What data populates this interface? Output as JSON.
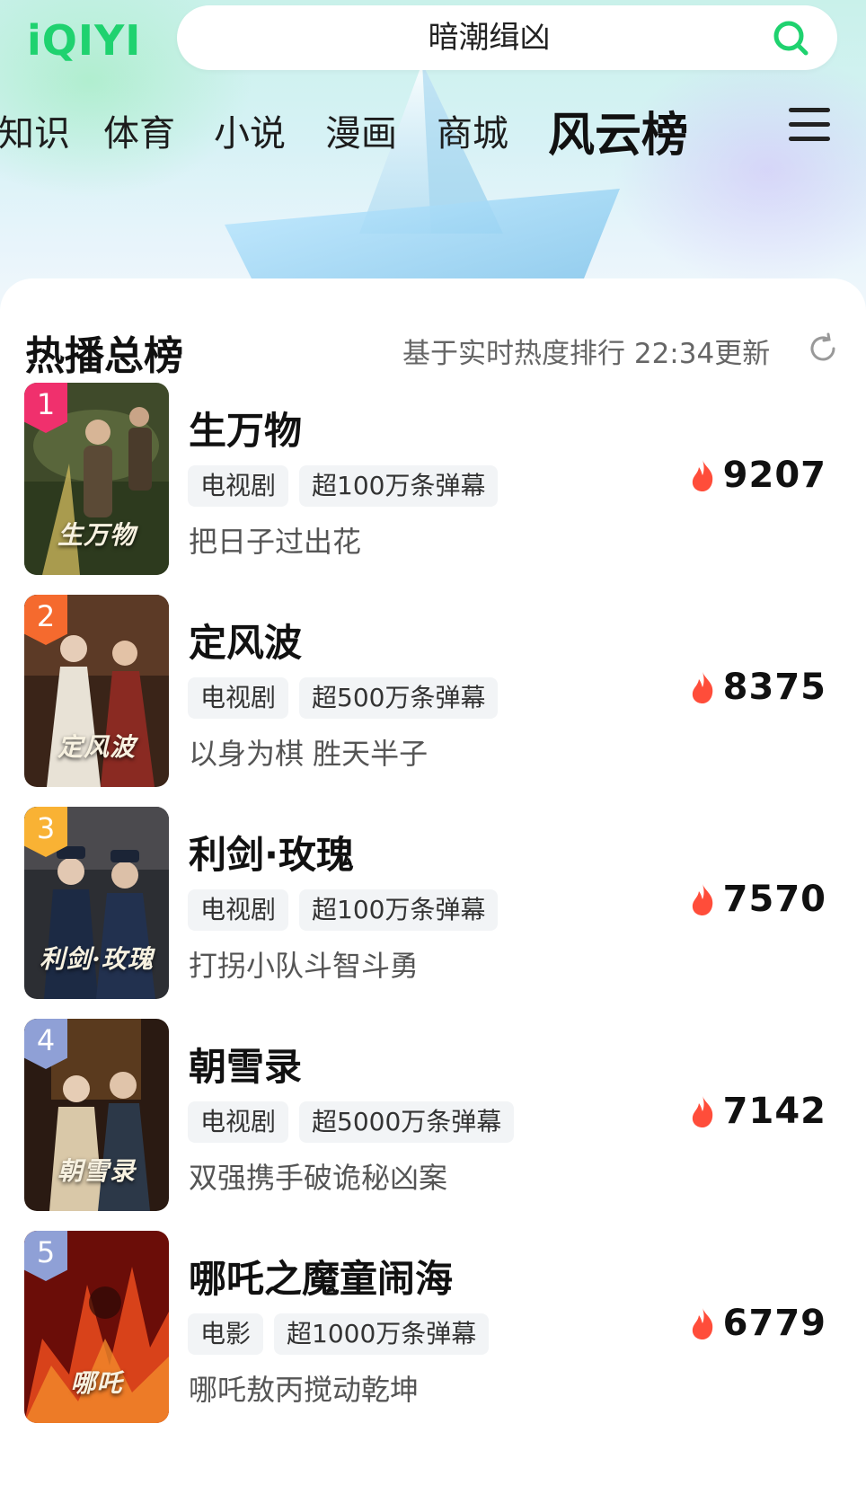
{
  "app": {
    "logo": "iQIYI"
  },
  "search": {
    "query": "暗潮缉凶"
  },
  "nav": {
    "tabs": [
      "知识",
      "体育",
      "小说",
      "漫画",
      "商城",
      "风云榜"
    ],
    "active": "风云榜"
  },
  "ranking": {
    "title": "热播总榜",
    "subtitle": "基于实时热度排行 22:34更新",
    "items": [
      {
        "rank": "1",
        "name": "生万物",
        "tags": [
          "电视剧",
          "超100万条弹幕"
        ],
        "desc": "把日子过出花",
        "heat": "9207",
        "poster_text": "生万物",
        "rank_color": "#f0306d"
      },
      {
        "rank": "2",
        "name": "定风波",
        "tags": [
          "电视剧",
          "超500万条弹幕"
        ],
        "desc": "以身为棋 胜天半子",
        "heat": "8375",
        "poster_text": "定风波",
        "rank_color": "#f56a2e"
      },
      {
        "rank": "3",
        "name": "利剑·玫瑰",
        "tags": [
          "电视剧",
          "超100万条弹幕"
        ],
        "desc": "打拐小队斗智斗勇",
        "heat": "7570",
        "poster_text": "利剑·玫瑰",
        "rank_color": "#f9b234"
      },
      {
        "rank": "4",
        "name": "朝雪录",
        "tags": [
          "电视剧",
          "超5000万条弹幕"
        ],
        "desc": "双强携手破诡秘凶案",
        "heat": "7142",
        "poster_text": "朝雪录",
        "rank_color": "#8fa0d6"
      },
      {
        "rank": "5",
        "name": "哪吒之魔童闹海",
        "tags": [
          "电影",
          "超1000万条弹幕"
        ],
        "desc": "哪吒敖丙搅动乾坤",
        "heat": "6779",
        "poster_text": "哪吒",
        "rank_color": "#8fa0d6"
      }
    ]
  },
  "colors": {
    "brand": "#1fd26f",
    "flame": "#ff4d3a"
  },
  "icons": {
    "search": "search-icon",
    "menu": "menu-icon",
    "refresh": "refresh-icon",
    "heat": "flame-icon"
  }
}
